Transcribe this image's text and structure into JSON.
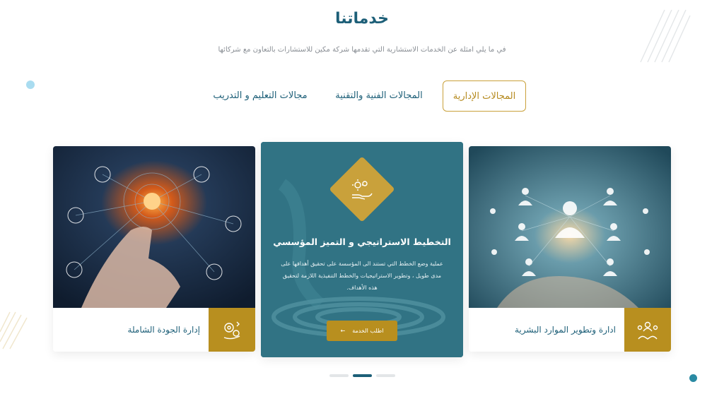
{
  "header": {
    "title": "خدماتنا",
    "subtitle": "في ما يلي امثلة عن الخدمات الاستشارية التي تقدمها شركة مكين للاستشارات بالتعاون مع شركائها"
  },
  "tabs": [
    {
      "label": "المجالات الإدارية",
      "active": true
    },
    {
      "label": "المجالات الفنية والتقنية",
      "active": false
    },
    {
      "label": "مجالات التعليم و التدريب",
      "active": false
    }
  ],
  "cards": {
    "right": {
      "title": "ادارة وتطوير الموارد البشرية",
      "icon": "hr-network-icon"
    },
    "center": {
      "title": "التخطيط الاستراتيجي و التميز المؤسسي",
      "description": "عملية وضع الخطط التي تستند الى المؤسسة على تحقيق أهدافها على مدى طويل ، وتطوير الاستراتيجيات والخطط التنفيذية اللازمة لتحقيق هذه الأهداف.",
      "button_label": "اطلب الخدمة",
      "button_icon": "arrow-left-icon",
      "icon": "strategy-hand-gears-icon"
    },
    "left": {
      "title": "إدارة الجودة الشاملة",
      "icon": "quality-gears-icon"
    }
  },
  "pager": {
    "pages": 3,
    "active": 2
  },
  "colors": {
    "primary": "#1d5f78",
    "accent": "#b88f1f",
    "center_bg": "#2c6d7e"
  }
}
